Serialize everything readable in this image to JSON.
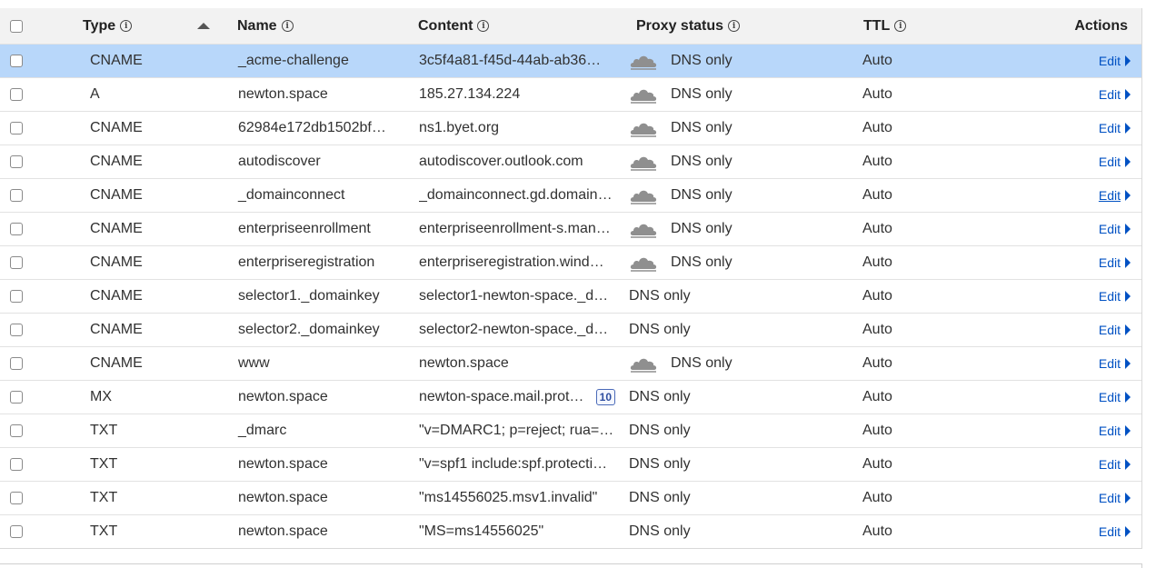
{
  "headers": {
    "type": "Type",
    "name": "Name",
    "content": "Content",
    "proxy": "Proxy status",
    "ttl": "TTL",
    "actions": "Actions",
    "info_glyph": "i"
  },
  "rows": [
    {
      "type": "CNAME",
      "name": "_acme-challenge",
      "content": "3c5f4a81-f45d-44ab-ab36…",
      "proxy": "DNS only",
      "cloud": true,
      "ttl": "Auto",
      "edit": "Edit",
      "selected": true
    },
    {
      "type": "A",
      "name": "newton.space",
      "content": "185.27.134.224",
      "proxy": "DNS only",
      "cloud": true,
      "ttl": "Auto",
      "edit": "Edit"
    },
    {
      "type": "CNAME",
      "name": "62984e172db1502bf…",
      "content": "ns1.byet.org",
      "proxy": "DNS only",
      "cloud": true,
      "ttl": "Auto",
      "edit": "Edit"
    },
    {
      "type": "CNAME",
      "name": "autodiscover",
      "content": "autodiscover.outlook.com",
      "proxy": "DNS only",
      "cloud": true,
      "ttl": "Auto",
      "edit": "Edit"
    },
    {
      "type": "CNAME",
      "name": "_domainconnect",
      "content": "_domainconnect.gd.domain…",
      "proxy": "DNS only",
      "cloud": true,
      "ttl": "Auto",
      "edit": "Edit",
      "hover": true
    },
    {
      "type": "CNAME",
      "name": "enterpriseenrollment",
      "content": "enterpriseenrollment-s.man…",
      "proxy": "DNS only",
      "cloud": true,
      "ttl": "Auto",
      "edit": "Edit"
    },
    {
      "type": "CNAME",
      "name": "enterpriseregistration",
      "content": "enterpriseregistration.wind…",
      "proxy": "DNS only",
      "cloud": true,
      "ttl": "Auto",
      "edit": "Edit"
    },
    {
      "type": "CNAME",
      "name": "selector1._domainkey",
      "content": "selector1-newton-space._d…",
      "proxy": "DNS only",
      "cloud": false,
      "ttl": "Auto",
      "edit": "Edit"
    },
    {
      "type": "CNAME",
      "name": "selector2._domainkey",
      "content": "selector2-newton-space._d…",
      "proxy": "DNS only",
      "cloud": false,
      "ttl": "Auto",
      "edit": "Edit"
    },
    {
      "type": "CNAME",
      "name": "www",
      "content": "newton.space",
      "proxy": "DNS only",
      "cloud": true,
      "ttl": "Auto",
      "edit": "Edit"
    },
    {
      "type": "MX",
      "name": "newton.space",
      "content": "newton-space.mail.prot…",
      "badge": "10",
      "proxy": "DNS only",
      "cloud": false,
      "ttl": "Auto",
      "edit": "Edit"
    },
    {
      "type": "TXT",
      "name": "_dmarc",
      "content": "\"v=DMARC1; p=reject; rua=…",
      "proxy": "DNS only",
      "cloud": false,
      "ttl": "Auto",
      "edit": "Edit"
    },
    {
      "type": "TXT",
      "name": "newton.space",
      "content": "\"v=spf1 include:spf.protecti…",
      "proxy": "DNS only",
      "cloud": false,
      "ttl": "Auto",
      "edit": "Edit"
    },
    {
      "type": "TXT",
      "name": "newton.space",
      "content": "\"ms14556025.msv1.invalid\"",
      "proxy": "DNS only",
      "cloud": false,
      "ttl": "Auto",
      "edit": "Edit"
    },
    {
      "type": "TXT",
      "name": "newton.space",
      "content": "\"MS=ms14556025\"",
      "proxy": "DNS only",
      "cloud": false,
      "ttl": "Auto",
      "edit": "Edit"
    }
  ],
  "colors": {
    "selected_row": "#b8d7fa",
    "link": "#0051c3",
    "cloud": "#8f8f8f",
    "header_bg": "#f2f2f2"
  }
}
